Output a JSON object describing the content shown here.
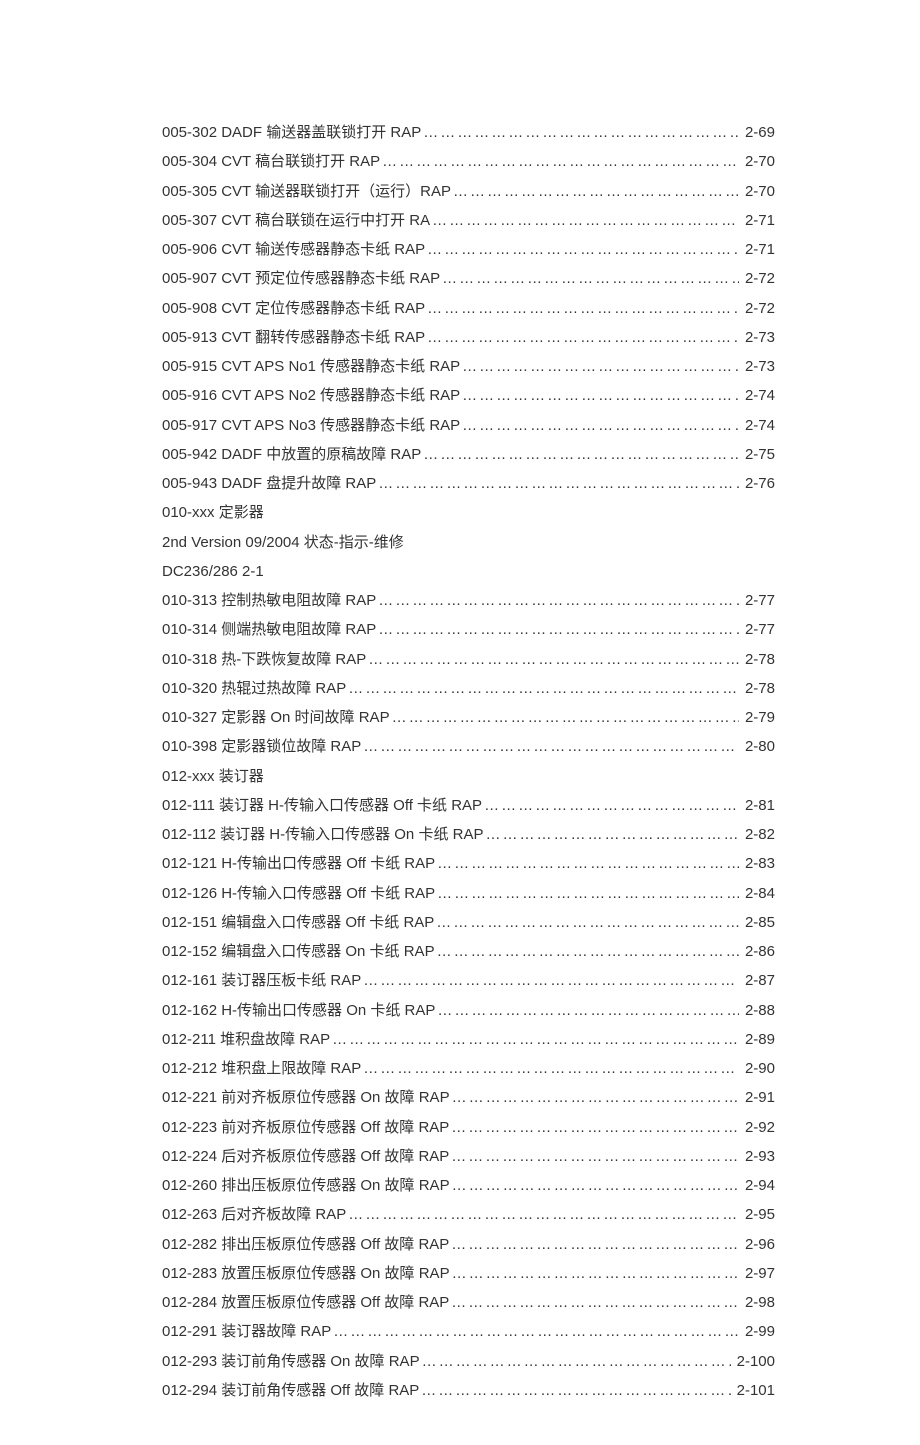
{
  "entries": [
    {
      "type": "toc",
      "title": "005-302 DADF 输送器盖联锁打开 RAP",
      "page": "2-69"
    },
    {
      "type": "toc",
      "title": "005-304 CVT 稿台联锁打开 RAP",
      "page": "2-70"
    },
    {
      "type": "toc",
      "title": "005-305 CVT 输送器联锁打开（运行）RAP",
      "page": "2-70"
    },
    {
      "type": "toc",
      "title": "005-307 CVT 稿台联锁在运行中打开 RA",
      "page": "2-71"
    },
    {
      "type": "toc",
      "title": "005-906 CVT 输送传感器静态卡纸 RAP",
      "page": "2-71"
    },
    {
      "type": "toc",
      "title": "005-907 CVT 预定位传感器静态卡纸 RAP",
      "page": "2-72"
    },
    {
      "type": "toc",
      "title": "005-908 CVT 定位传感器静态卡纸 RAP",
      "page": "2-72"
    },
    {
      "type": "toc",
      "title": "005-913 CVT 翻转传感器静态卡纸 RAP",
      "page": "2-73"
    },
    {
      "type": "toc",
      "title": "005-915 CVT APS No1 传感器静态卡纸 RAP",
      "page": "2-73"
    },
    {
      "type": "toc",
      "title": "005-916 CVT APS No2 传感器静态卡纸 RAP",
      "page": "2-74"
    },
    {
      "type": "toc",
      "title": "005-917 CVT APS No3 传感器静态卡纸 RAP",
      "page": "2-74"
    },
    {
      "type": "toc",
      "title": "005-942 DADF 中放置的原稿故障 RAP",
      "page": "2-75"
    },
    {
      "type": "toc",
      "title": "005-943 DADF 盘提升故障 RAP",
      "page": "2-76"
    },
    {
      "type": "heading",
      "title": "010-xxx 定影器"
    },
    {
      "type": "heading",
      "title": "2nd Version 09/2004 状态-指示-维修"
    },
    {
      "type": "heading",
      "title": "DC236/286 2-1"
    },
    {
      "type": "toc",
      "title": "010-313 控制热敏电阻故障 RAP",
      "page": "2-77"
    },
    {
      "type": "toc",
      "title": "010-314 侧端热敏电阻故障 RAP",
      "page": "2-77"
    },
    {
      "type": "toc",
      "title": "010-318 热-下跌恢复故障 RAP",
      "page": "2-78"
    },
    {
      "type": "toc",
      "title": "010-320 热辊过热故障 RAP",
      "page": "2-78"
    },
    {
      "type": "toc",
      "title": "010-327 定影器 On 时间故障 RAP",
      "page": "2-79"
    },
    {
      "type": "toc",
      "title": "010-398 定影器锁位故障 RAP",
      "page": "2-80"
    },
    {
      "type": "heading",
      "title": "012-xxx 装订器"
    },
    {
      "type": "toc",
      "title": "012-111 装订器 H-传输入口传感器 Off 卡纸 RAP",
      "page": "2-81"
    },
    {
      "type": "toc",
      "title": "012-112 装订器 H-传输入口传感器 On 卡纸 RAP",
      "page": "2-82"
    },
    {
      "type": "toc",
      "title": "012-121 H-传输出口传感器 Off 卡纸 RAP",
      "page": "2-83"
    },
    {
      "type": "toc",
      "title": "012-126 H-传输入口传感器 Off 卡纸 RAP",
      "page": "2-84"
    },
    {
      "type": "toc",
      "title": "012-151 编辑盘入口传感器 Off 卡纸 RAP",
      "page": "2-85"
    },
    {
      "type": "toc",
      "title": "012-152 编辑盘入口传感器 On 卡纸 RAP",
      "page": "2-86"
    },
    {
      "type": "toc",
      "title": "012-161 装订器压板卡纸 RAP",
      "page": "2-87"
    },
    {
      "type": "toc",
      "title": "012-162 H-传输出口传感器 On 卡纸 RAP",
      "page": "2-88"
    },
    {
      "type": "toc",
      "title": "012-211 堆积盘故障 RAP",
      "page": "2-89"
    },
    {
      "type": "toc",
      "title": "012-212 堆积盘上限故障 RAP",
      "page": "2-90"
    },
    {
      "type": "toc",
      "title": "012-221 前对齐板原位传感器 On 故障 RAP",
      "page": "2-91"
    },
    {
      "type": "toc",
      "title": "012-223 前对齐板原位传感器 Off 故障 RAP",
      "page": "2-92"
    },
    {
      "type": "toc",
      "title": "012-224 后对齐板原位传感器 Off 故障 RAP",
      "page": "2-93"
    },
    {
      "type": "toc",
      "title": "012-260 排出压板原位传感器 On 故障 RAP",
      "page": "2-94"
    },
    {
      "type": "toc",
      "title": "012-263 后对齐板故障 RAP",
      "page": "2-95"
    },
    {
      "type": "toc",
      "title": "012-282 排出压板原位传感器 Off 故障 RAP",
      "page": "2-96"
    },
    {
      "type": "toc",
      "title": "012-283 放置压板原位传感器 On 故障 RAP",
      "page": "2-97"
    },
    {
      "type": "toc",
      "title": "012-284 放置压板原位传感器 Off 故障 RAP",
      "page": "2-98"
    },
    {
      "type": "toc",
      "title": "012-291 装订器故障 RAP",
      "page": "2-99"
    },
    {
      "type": "toc",
      "title": "012-293 装订前角传感器 On 故障 RAP",
      "page": "2-100"
    },
    {
      "type": "toc",
      "title": "012-294 装订前角传感器 Off 故障 RAP",
      "page": "2-101"
    }
  ]
}
